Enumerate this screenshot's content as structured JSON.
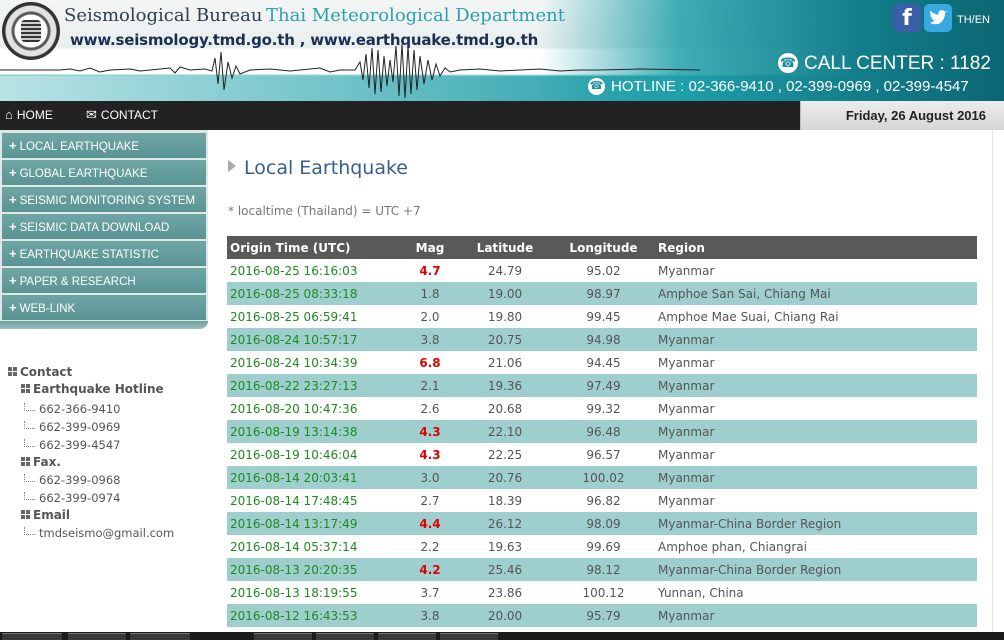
{
  "banner": {
    "bureau": "Seismological Bureau",
    "department": "Thai Meteorological Department",
    "urls": "www.seismology.tmd.go.th , www.earthquake.tmd.go.th",
    "call_center": "CALL CENTER : 1182",
    "hotline": "HOTLINE : 02-366-9410 , 02-399-0969 , 02-399-4547",
    "lang": "TH/EN",
    "icons": [
      "emblem-seal",
      "facebook-icon",
      "twitter-icon",
      "phone-icon"
    ],
    "colors": {
      "teal": "#1e9aa6",
      "navy": "#1c2e52"
    }
  },
  "topnav": {
    "home": "HOME",
    "contact": "CONTACT",
    "date": "Friday, 26 August 2016"
  },
  "sidebar": {
    "menu": [
      "LOCAL EARTHQUAKE",
      "GLOBAL EARTHQUAKE",
      "SEISMIC MONITORING SYSTEM",
      "SEISMIC DATA DOWNLOAD",
      "EARTHQUAKE STATISTIC",
      "PAPER & RESEARCH",
      "WEB-LINK"
    ],
    "contact": {
      "title": "Contact",
      "hotline_title": "Earthquake Hotline",
      "hotline": [
        "662-366-9410",
        "662-399-0969",
        "662-399-4547"
      ],
      "fax_title": "Fax.",
      "fax": [
        "662-399-0968",
        "662-399-0974"
      ],
      "email_title": "Email",
      "email": "tmdseismo@gmail.com"
    }
  },
  "main": {
    "heading": "Local Earthquake",
    "note": "* localtime (Thailand) = UTC +7",
    "columns": [
      "Origin Time (UTC)",
      "Mag",
      "Latitude",
      "Longitude",
      "Region"
    ],
    "rows": [
      [
        "2016-08-25 16:16:03",
        "4.7",
        "24.79",
        "95.02",
        "Myanmar"
      ],
      [
        "2016-08-25 08:33:18",
        "1.8",
        "19.00",
        "98.97",
        "Amphoe San Sai, Chiang Mai"
      ],
      [
        "2016-08-25 06:59:41",
        "2.0",
        "19.80",
        "99.45",
        "Amphoe Mae Suai, Chiang Rai"
      ],
      [
        "2016-08-24 10:57:17",
        "3.8",
        "20.75",
        "94.98",
        "Myanmar"
      ],
      [
        "2016-08-24 10:34:39",
        "6.8",
        "21.06",
        "94.45",
        "Myanmar"
      ],
      [
        "2016-08-22 23:27:13",
        "2.1",
        "19.36",
        "97.49",
        "Myanmar"
      ],
      [
        "2016-08-20 10:47:36",
        "2.6",
        "20.68",
        "99.32",
        "Myanmar"
      ],
      [
        "2016-08-19 13:14:38",
        "4.3",
        "22.10",
        "96.48",
        "Myanmar"
      ],
      [
        "2016-08-19 10:46:04",
        "4.3",
        "22.25",
        "96.57",
        "Myanmar"
      ],
      [
        "2016-08-14 20:03:41",
        "3.0",
        "20.76",
        "100.02",
        "Myanmar"
      ],
      [
        "2016-08-14 17:48:45",
        "2.7",
        "18.39",
        "96.82",
        "Myanmar"
      ],
      [
        "2016-08-14 13:17:49",
        "4.4",
        "26.12",
        "98.09",
        "Myanmar-China Border Region"
      ],
      [
        "2016-08-14 05:37:14",
        "2.2",
        "19.63",
        "99.69",
        "Amphoe phan, Chiangrai"
      ],
      [
        "2016-08-13 20:20:35",
        "4.2",
        "25.46",
        "98.12",
        "Myanmar-China Border Region"
      ],
      [
        "2016-08-13 18:19:55",
        "3.7",
        "23.86",
        "100.12",
        "Yunnan, China"
      ],
      [
        "2016-08-12 16:43:53",
        "3.8",
        "20.00",
        "95.79",
        "Myanmar"
      ]
    ],
    "colors": {
      "header_bg": "#595959",
      "row_alt": "#9ecfce",
      "time_text": "#1f8a1f",
      "big_mag": "#e00000"
    }
  }
}
